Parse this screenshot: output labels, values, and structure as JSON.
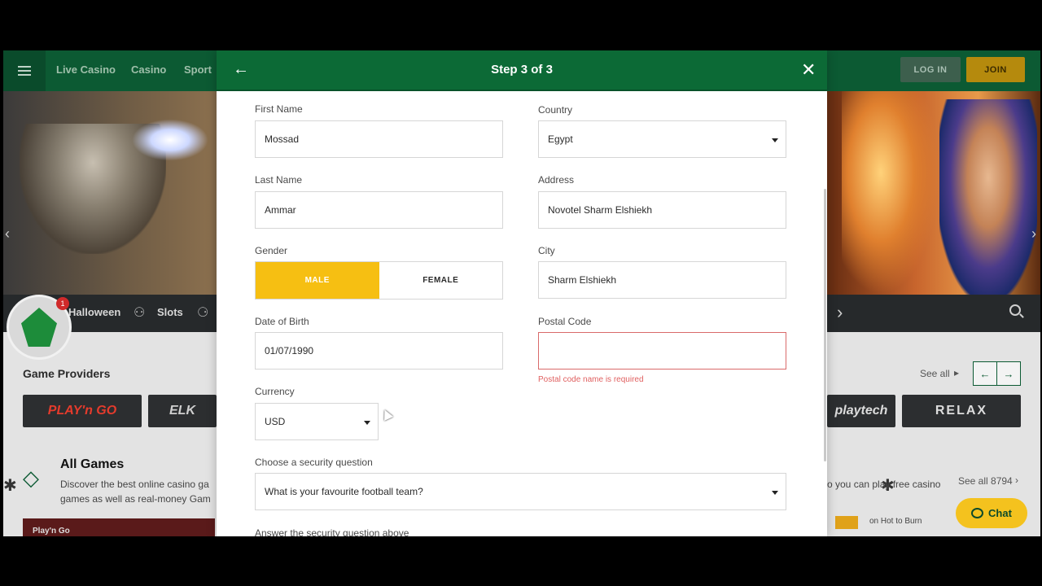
{
  "site": {
    "nav": [
      "Live Casino",
      "Casino",
      "Sport"
    ],
    "login_label": "LOG IN",
    "join_label": "JOIN",
    "categories": [
      "Halloween",
      "Slots"
    ],
    "notification_count": "1",
    "providers_title": "Game Providers",
    "providers_see_all": "See all",
    "providers": [
      "PLAY'n GO",
      "ELK",
      "playtech",
      "RELAX"
    ],
    "all_games_title": "All Games",
    "all_games_desc": "Discover the best online casino ga games as well as real-money Gam",
    "right_desc": "o you can play free casino",
    "all_games_see_all": "See all 8794",
    "thumb_label": "Play'n Go",
    "hot_label": "on Hot to Burn",
    "chat_label": "Chat"
  },
  "modal": {
    "title": "Step 3 of 3",
    "first_name": {
      "label": "First Name",
      "value": "Mossad"
    },
    "last_name": {
      "label": "Last Name",
      "value": "Ammar"
    },
    "gender": {
      "label": "Gender",
      "male": "MALE",
      "female": "FEMALE",
      "selected": "MALE"
    },
    "dob": {
      "label": "Date of Birth",
      "value": "01/07/1990"
    },
    "currency": {
      "label": "Currency",
      "value": "USD"
    },
    "country": {
      "label": "Country",
      "value": "Egypt"
    },
    "address": {
      "label": "Address",
      "value": "Novotel Sharm Elshiekh"
    },
    "city": {
      "label": "City",
      "value": "Sharm Elshiekh"
    },
    "postal": {
      "label": "Postal Code",
      "value": "",
      "error": "Postal code name is required"
    },
    "security_q": {
      "label": "Choose a security question",
      "value": "What is your favourite football team?"
    },
    "answer_label": "Answer the security question above"
  },
  "colors": {
    "header_green": "#0c6a36",
    "accent_yellow": "#f6bf12",
    "error_red": "#e06060"
  }
}
